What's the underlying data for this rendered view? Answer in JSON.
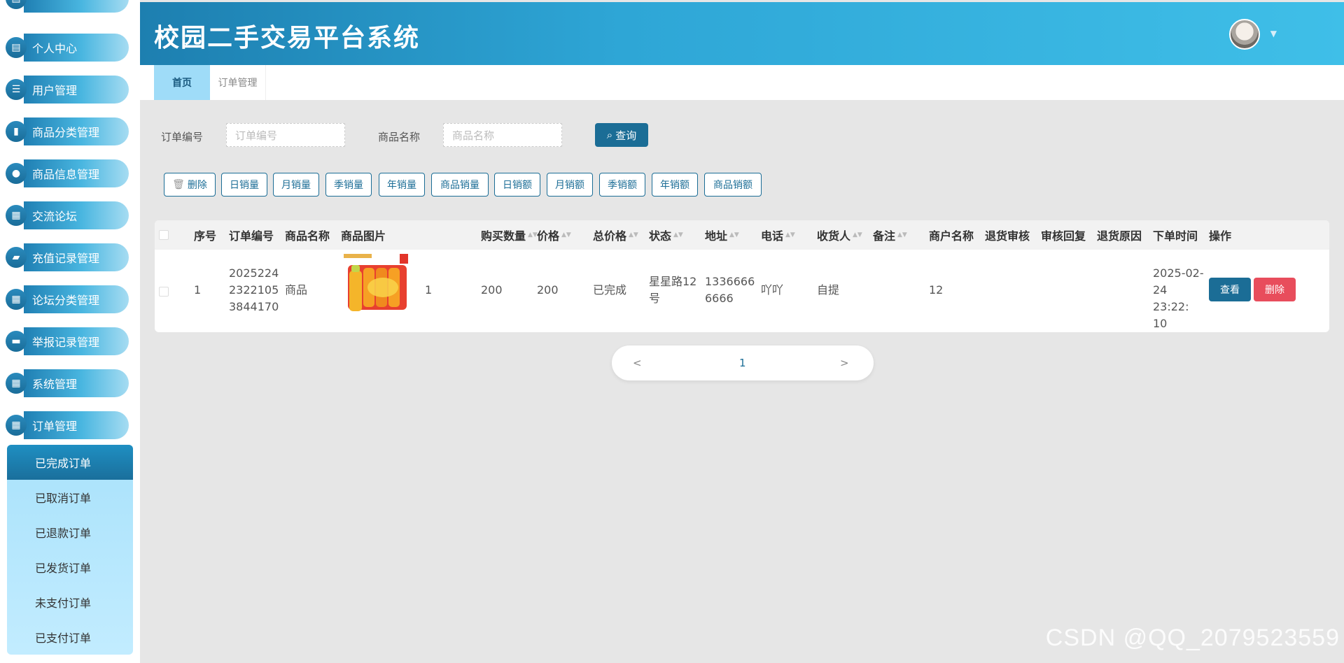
{
  "sidebar": {
    "items": [
      {
        "label": "个人中心",
        "icon": "profile-icon",
        "glyph": "▤"
      },
      {
        "label": "用户管理",
        "icon": "list-icon",
        "glyph": "☰"
      },
      {
        "label": "商品分类管理",
        "icon": "book-icon",
        "glyph": "▮"
      },
      {
        "label": "商品信息管理",
        "icon": "bulb-icon",
        "glyph": "●"
      },
      {
        "label": "交流论坛",
        "icon": "grid-icon",
        "glyph": "▦"
      },
      {
        "label": "充值记录管理",
        "icon": "wallet-icon",
        "glyph": "▰"
      },
      {
        "label": "论坛分类管理",
        "icon": "grid-icon",
        "glyph": "▦"
      },
      {
        "label": "举报记录管理",
        "icon": "comment-icon",
        "glyph": "▬"
      },
      {
        "label": "系统管理",
        "icon": "apps-icon",
        "glyph": "▦"
      },
      {
        "label": "订单管理",
        "icon": "grid-icon",
        "glyph": "▦"
      }
    ],
    "submenu": [
      "已完成订单",
      "已取消订单",
      "已退款订单",
      "已发货订单",
      "未支付订单",
      "已支付订单"
    ]
  },
  "header": {
    "title": "校园二手交易平台系统",
    "caret": "▼"
  },
  "tabs": [
    {
      "label": "首页"
    },
    {
      "label": "订单管理"
    }
  ],
  "search": {
    "order_no_label": "订单编号",
    "order_no_placeholder": "订单编号",
    "product_label": "商品名称",
    "product_placeholder": "商品名称",
    "button": "查询"
  },
  "actions": [
    "删除",
    "日销量",
    "月销量",
    "季销量",
    "年销量",
    "商品销量",
    "日销额",
    "月销额",
    "季销额",
    "年销额",
    "商品销额"
  ],
  "table": {
    "headers": [
      "序号",
      "订单编号",
      "商品名称",
      "商品图片",
      "购买数量",
      "价格",
      "总价格",
      "状态",
      "地址",
      "电话",
      "收货人",
      "备注",
      "商户名称",
      "退货审核",
      "审核回复",
      "退货原因",
      "下单时间",
      "操作"
    ],
    "row": {
      "index": "1",
      "order_no": "2025224 2322105 3844170",
      "product_name": "商品",
      "quantity": "1",
      "price": "200",
      "total": "200",
      "status": "已完成",
      "address": "星星路12 号",
      "phone": "1336666 6666",
      "receiver": "吖吖",
      "note": "自提",
      "merchant": "12",
      "order_time": "2025-02- 24 23:22: 10",
      "view_btn": "查看",
      "delete_btn": "删除"
    }
  },
  "pagination": {
    "prev": "<",
    "page": "1",
    "next": ">"
  },
  "watermark": "CSDN @QQ_2079523559",
  "colors": {
    "primary": "#1b6d96",
    "danger": "#e84d5c",
    "header_start": "#1d7fb0",
    "header_end": "#3fbfe8"
  }
}
